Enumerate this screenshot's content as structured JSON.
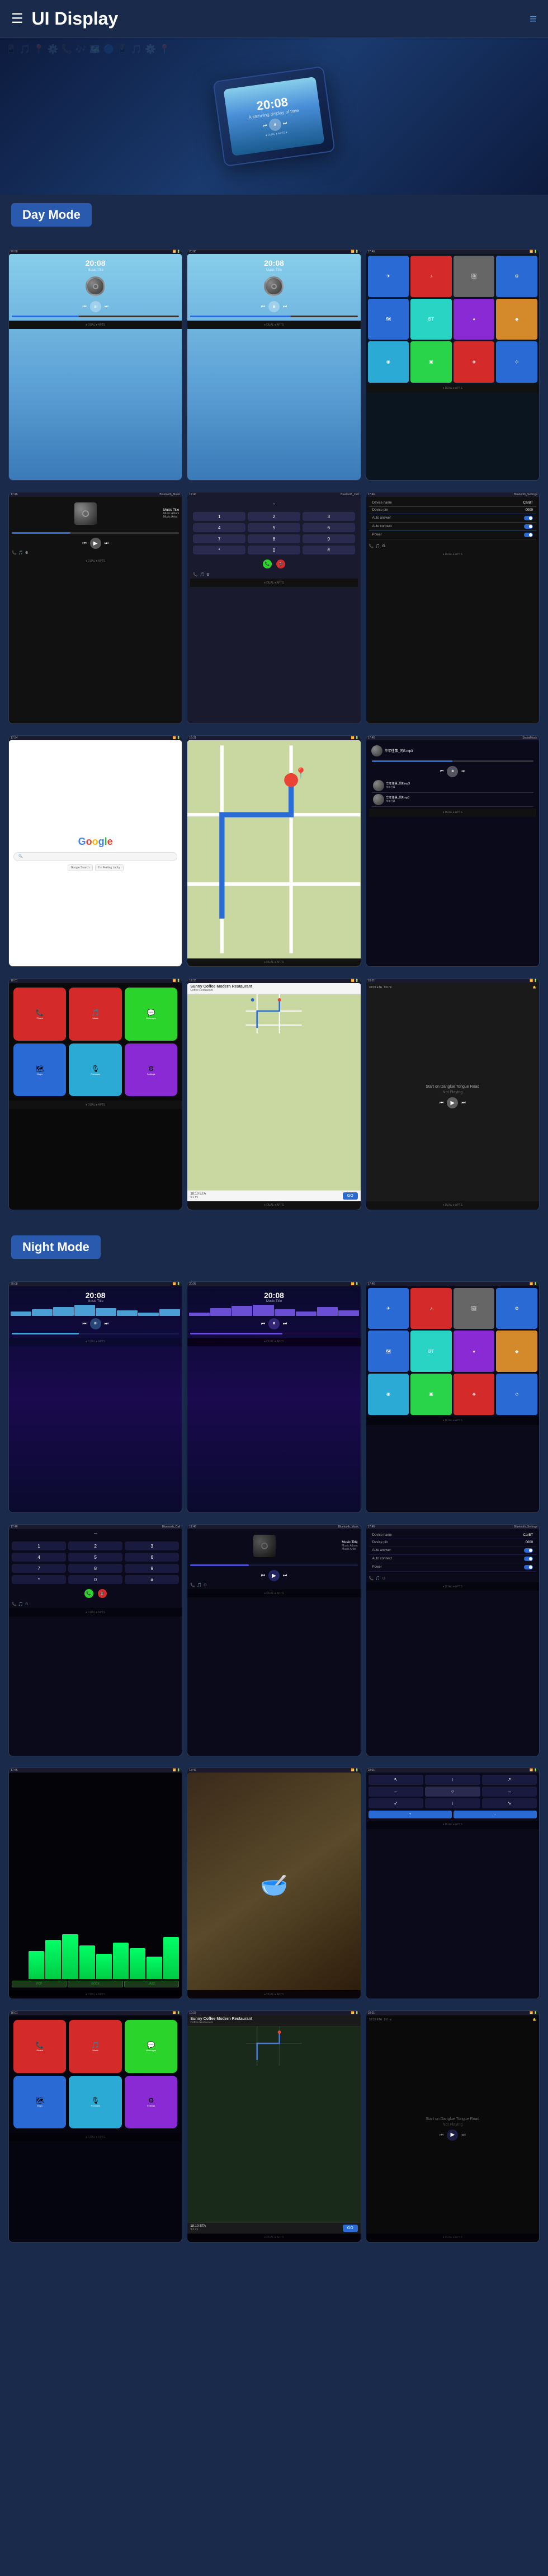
{
  "header": {
    "title": "UI Display",
    "menu_icon": "☰",
    "hamburger": "≡"
  },
  "hero": {
    "time": "20:08",
    "subtitle": "A stunning display of time"
  },
  "day_mode": {
    "label": "Day Mode",
    "screens": [
      {
        "id": "day-music-1",
        "type": "music",
        "time": "20:08",
        "subtitle": "Music Title"
      },
      {
        "id": "day-music-2",
        "type": "music",
        "time": "20:08",
        "subtitle": "Music Title"
      },
      {
        "id": "day-apps",
        "type": "apps"
      },
      {
        "id": "day-bluetooth-music",
        "type": "bt-music",
        "label": "Bluetooth_Music",
        "track": "Music Title",
        "album": "Music Album",
        "artist": "Music Artist"
      },
      {
        "id": "day-bluetooth-call",
        "type": "bt-call",
        "label": "Bluetooth_Call"
      },
      {
        "id": "day-bluetooth-settings",
        "type": "bt-settings",
        "label": "Bluetooth_Settings",
        "device_name": "CarBT",
        "device_pin": "0000",
        "auto_answer": true,
        "auto_connect": true
      },
      {
        "id": "day-google",
        "type": "google"
      },
      {
        "id": "day-map",
        "type": "map"
      },
      {
        "id": "day-social",
        "type": "social",
        "label": "SocialMusic"
      }
    ]
  },
  "carplay_row": {
    "screens": [
      {
        "id": "carplay-home",
        "type": "carplay-apps"
      },
      {
        "id": "carplay-nav",
        "type": "navigation",
        "restaurant": "Sunny Coffee Modern Restaurant",
        "distance": "10/19 ETA",
        "time": "18:10 ETA"
      },
      {
        "id": "carplay-music",
        "type": "carplay-music",
        "start_on": "Start on Danglue Tongue Road",
        "not_playing": "Not Playing"
      }
    ]
  },
  "night_mode": {
    "label": "Night Mode",
    "screens": [
      {
        "id": "night-music-1",
        "type": "night-music",
        "time": "20:08"
      },
      {
        "id": "night-music-2",
        "type": "night-music",
        "time": "20:08"
      },
      {
        "id": "night-apps",
        "type": "night-apps"
      },
      {
        "id": "night-bt-call",
        "type": "night-bt-call",
        "label": "Bluetooth_Call"
      },
      {
        "id": "night-bt-music",
        "type": "night-bt-music",
        "label": "Bluetooth_Music",
        "track": "Music Title",
        "album": "Music Album",
        "artist": "Music Artist"
      },
      {
        "id": "night-bt-settings",
        "type": "night-bt-settings",
        "label": "Bluetooth_Settings"
      },
      {
        "id": "night-eq",
        "type": "night-eq"
      },
      {
        "id": "night-food",
        "type": "night-food"
      },
      {
        "id": "night-nav-controls",
        "type": "night-nav-controls"
      }
    ]
  },
  "night_carplay_row": {
    "screens": [
      {
        "id": "night-carplay-home",
        "type": "night-carplay"
      },
      {
        "id": "night-carplay-nav",
        "type": "night-navigation",
        "restaurant": "Sunny Coffee Modern Restaurant",
        "eta": "18:10 ETA"
      },
      {
        "id": "night-carplay-music",
        "type": "night-carplay-music",
        "not_playing": "Not Playing"
      }
    ]
  },
  "music_album": {
    "title": "Music Album",
    "artist": "Music Artist"
  },
  "night_mode_label": "Night Mode"
}
